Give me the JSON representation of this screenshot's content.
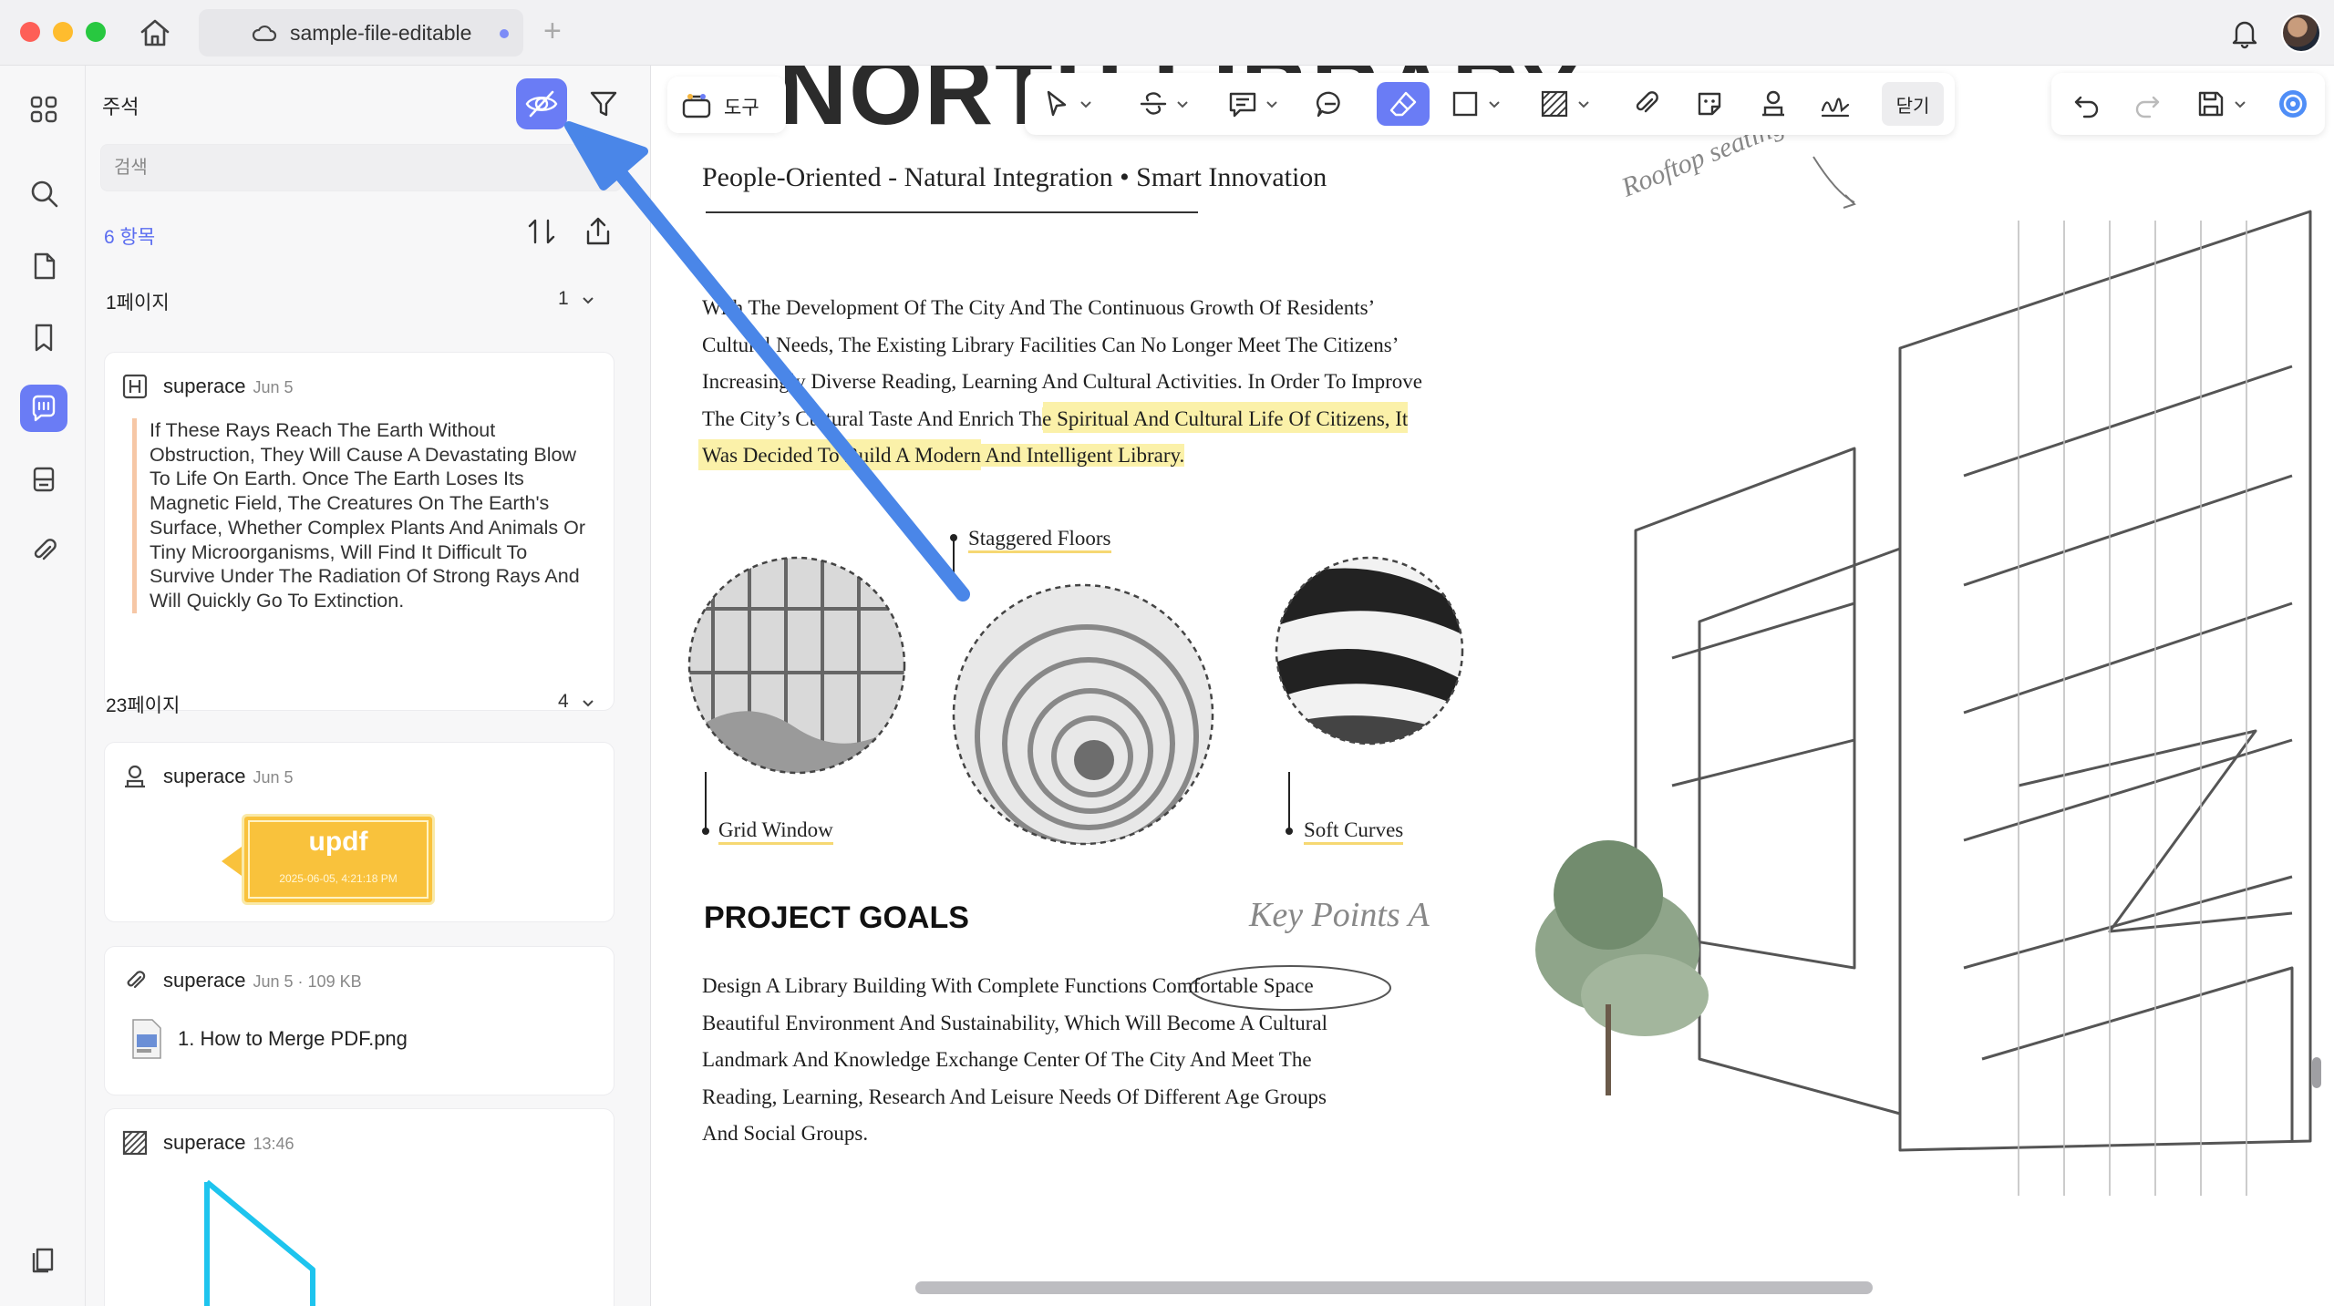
{
  "window": {
    "tab_title": "sample-file-editable",
    "new_tab_glyph": "+"
  },
  "panel": {
    "title": "주석",
    "search_placeholder": "검색",
    "count_label": "6 항목",
    "groups": [
      {
        "label": "1페이지",
        "count": "1"
      },
      {
        "label": "23페이지",
        "count": "4"
      }
    ],
    "cards": [
      {
        "type": "highlight",
        "author": "superace",
        "meta": "Jun 5",
        "quote": "If These Rays Reach The Earth Without Obstruction, They Will Cause A Devastating Blow To Life On Earth. Once The Earth Loses Its Magnetic Field, The Creatures On The Earth's Surface, Whether Complex Plants And Animals Or Tiny Microorganisms, Will Find It Difficult To Survive Under The Radiation Of Strong Rays And Will Quickly Go To Extinction."
      },
      {
        "type": "stamp",
        "author": "superace",
        "meta": "Jun 5",
        "stamp_text": "updf",
        "stamp_date": "2025-06-05, 4:21:18 PM"
      },
      {
        "type": "attachment",
        "author": "superace",
        "meta": "Jun 5 · 109 KB",
        "file_name": "1. How to Merge PDF.png"
      },
      {
        "type": "shape",
        "author": "superace",
        "meta": "13:46"
      }
    ]
  },
  "toolbar": {
    "tools_label": "도구",
    "close_label": "닫기"
  },
  "document": {
    "big_title": "NORTH LIBRARY",
    "subtitle": "People-Oriented - Natural Integration • Smart Innovation",
    "intro_lines": [
      "With The Development Of The City And The Continuous Growth Of Residents’",
      "Cultural Needs, The Existing Library Facilities Can No Longer Meet The Citizens’",
      "Increasingly Diverse Reading, Learning And Cultural Activities. In Order To Improve"
    ],
    "intro_line4_plain": "The City’s Cultural Taste And Enrich Th",
    "intro_line4_highlight": "e Spiritual And Cultural Life Of Citizens, It",
    "intro_line5": "Was Decided To Build A Modern And Intelligent Library.",
    "labels": {
      "staggered": "Staggered Floors",
      "grid": "Grid Window",
      "soft": "Soft Curves"
    },
    "goals_heading": "PROJECT GOALS",
    "keypoints": "Key Points A",
    "rooftop": "Rooftop seating area",
    "goals_lines": [
      "Design A Library Building With Complete Functions Comfortable Space",
      "Beautiful Environment And Sustainability, Which Will Become A Cultural",
      "Landmark And Knowledge Exchange Center Of The City And Meet The",
      "Reading, Learning, Research And Leisure Needs Of Different Age Groups",
      "And Social Groups."
    ]
  },
  "colors": {
    "accent": "#6a7cf5",
    "arrow": "#4a86e8",
    "highlight": "#fbf1a9",
    "stamp": "#f9c23c"
  }
}
